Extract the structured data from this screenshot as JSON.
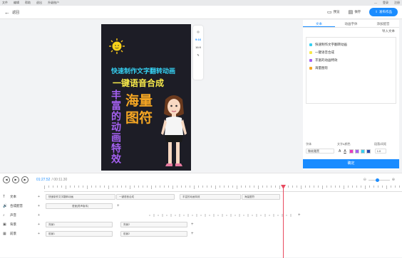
{
  "menu": {
    "items": [
      "文件",
      "编辑",
      "帮助",
      "退出",
      "升级账户"
    ],
    "right": [
      "—",
      "登录",
      "注册"
    ]
  },
  "toolbar": {
    "back_label": "返回",
    "preview_label": "预览",
    "save_label": "保存",
    "publish_label": "发布作品"
  },
  "canvas": {
    "line1": "快速制作文字翻转动画",
    "line2": "一键语音合成",
    "vertical": "丰富的动画特效",
    "big1": "海量",
    "big2": "图符"
  },
  "side_tools": {
    "ratio_916": "9:16",
    "ratio_169": "16:9"
  },
  "panel": {
    "tabs": [
      "文本",
      "动画字体",
      "添加配音"
    ],
    "import_label": "导入文本",
    "text_items": [
      {
        "label": "快速制作文字翻转动画",
        "color": "#35d0f2"
      },
      {
        "label": "一键语音合成",
        "color": "#f7e94a"
      },
      {
        "label": "丰富的动画特效",
        "color": "#a460f0"
      },
      {
        "label": "海量图符",
        "color": "#f5a623"
      }
    ],
    "font_label": "字体",
    "style_label": "文字&颜色",
    "spacing_label": "段落/间距",
    "font_value": "微软雅黑",
    "spacing_value": "1.0",
    "confirm_label": "确定",
    "swatch_colors": [
      "#e83cbf",
      "#a460f0",
      "#35d0f2",
      "#2a4ab0"
    ]
  },
  "timeline": {
    "current_time": "01:27.52",
    "total_time": "/ 00:11.30",
    "tracks": [
      {
        "name": "文本",
        "icon": "T"
      },
      {
        "name": "合成配音",
        "icon": "🔊"
      },
      {
        "name": "声音",
        "icon": "♪"
      },
      {
        "name": "背景",
        "icon": "▣"
      },
      {
        "name": "前景",
        "icon": "▦"
      }
    ],
    "clips": {
      "text1": "快速制作文字翻转动画",
      "text2": "一键语音合成",
      "text3": "丰富的动画特效",
      "text4": "海量图符",
      "voice": "语速(男声版本)",
      "bg1": "背景1",
      "bg2": "背景2",
      "fg1": "前景1",
      "fg2": "前景2"
    }
  }
}
